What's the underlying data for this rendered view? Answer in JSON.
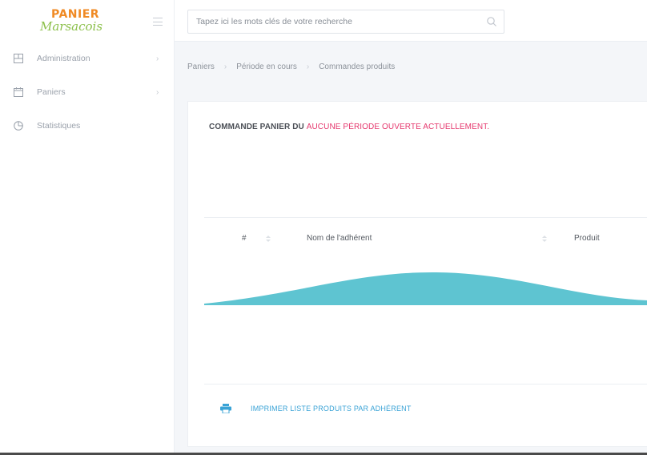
{
  "app": {
    "logo_top": "PANIER",
    "logo_bottom": "Marsacois"
  },
  "search": {
    "placeholder": "Tapez ici les mots clés de votre recherche"
  },
  "sidebar": {
    "items": [
      {
        "label": "Administration",
        "icon": "grid-icon"
      },
      {
        "label": "Paniers",
        "icon": "calendar-icon"
      },
      {
        "label": "Statistiques",
        "icon": "pie-chart-icon"
      }
    ]
  },
  "breadcrumb": [
    "Paniers",
    "Période en cours",
    "Commandes produits"
  ],
  "card": {
    "title_prefix": "COMMANDE PANIER DU ",
    "title_alert": "AUCUNE PÉRIODE OUVERTE ACTUELLEMENT.",
    "columns": [
      "#",
      "Nom de l'adhérent",
      "Produit"
    ],
    "print_label": "IMPRIMER LISTE PRODUITS PAR ADHÉRENT"
  },
  "colors": {
    "accent": "#e5386e",
    "link": "#3aa3d6",
    "wave": "#5ec4d1",
    "logo_orange": "#f08a24",
    "logo_green": "#8cc04b"
  }
}
